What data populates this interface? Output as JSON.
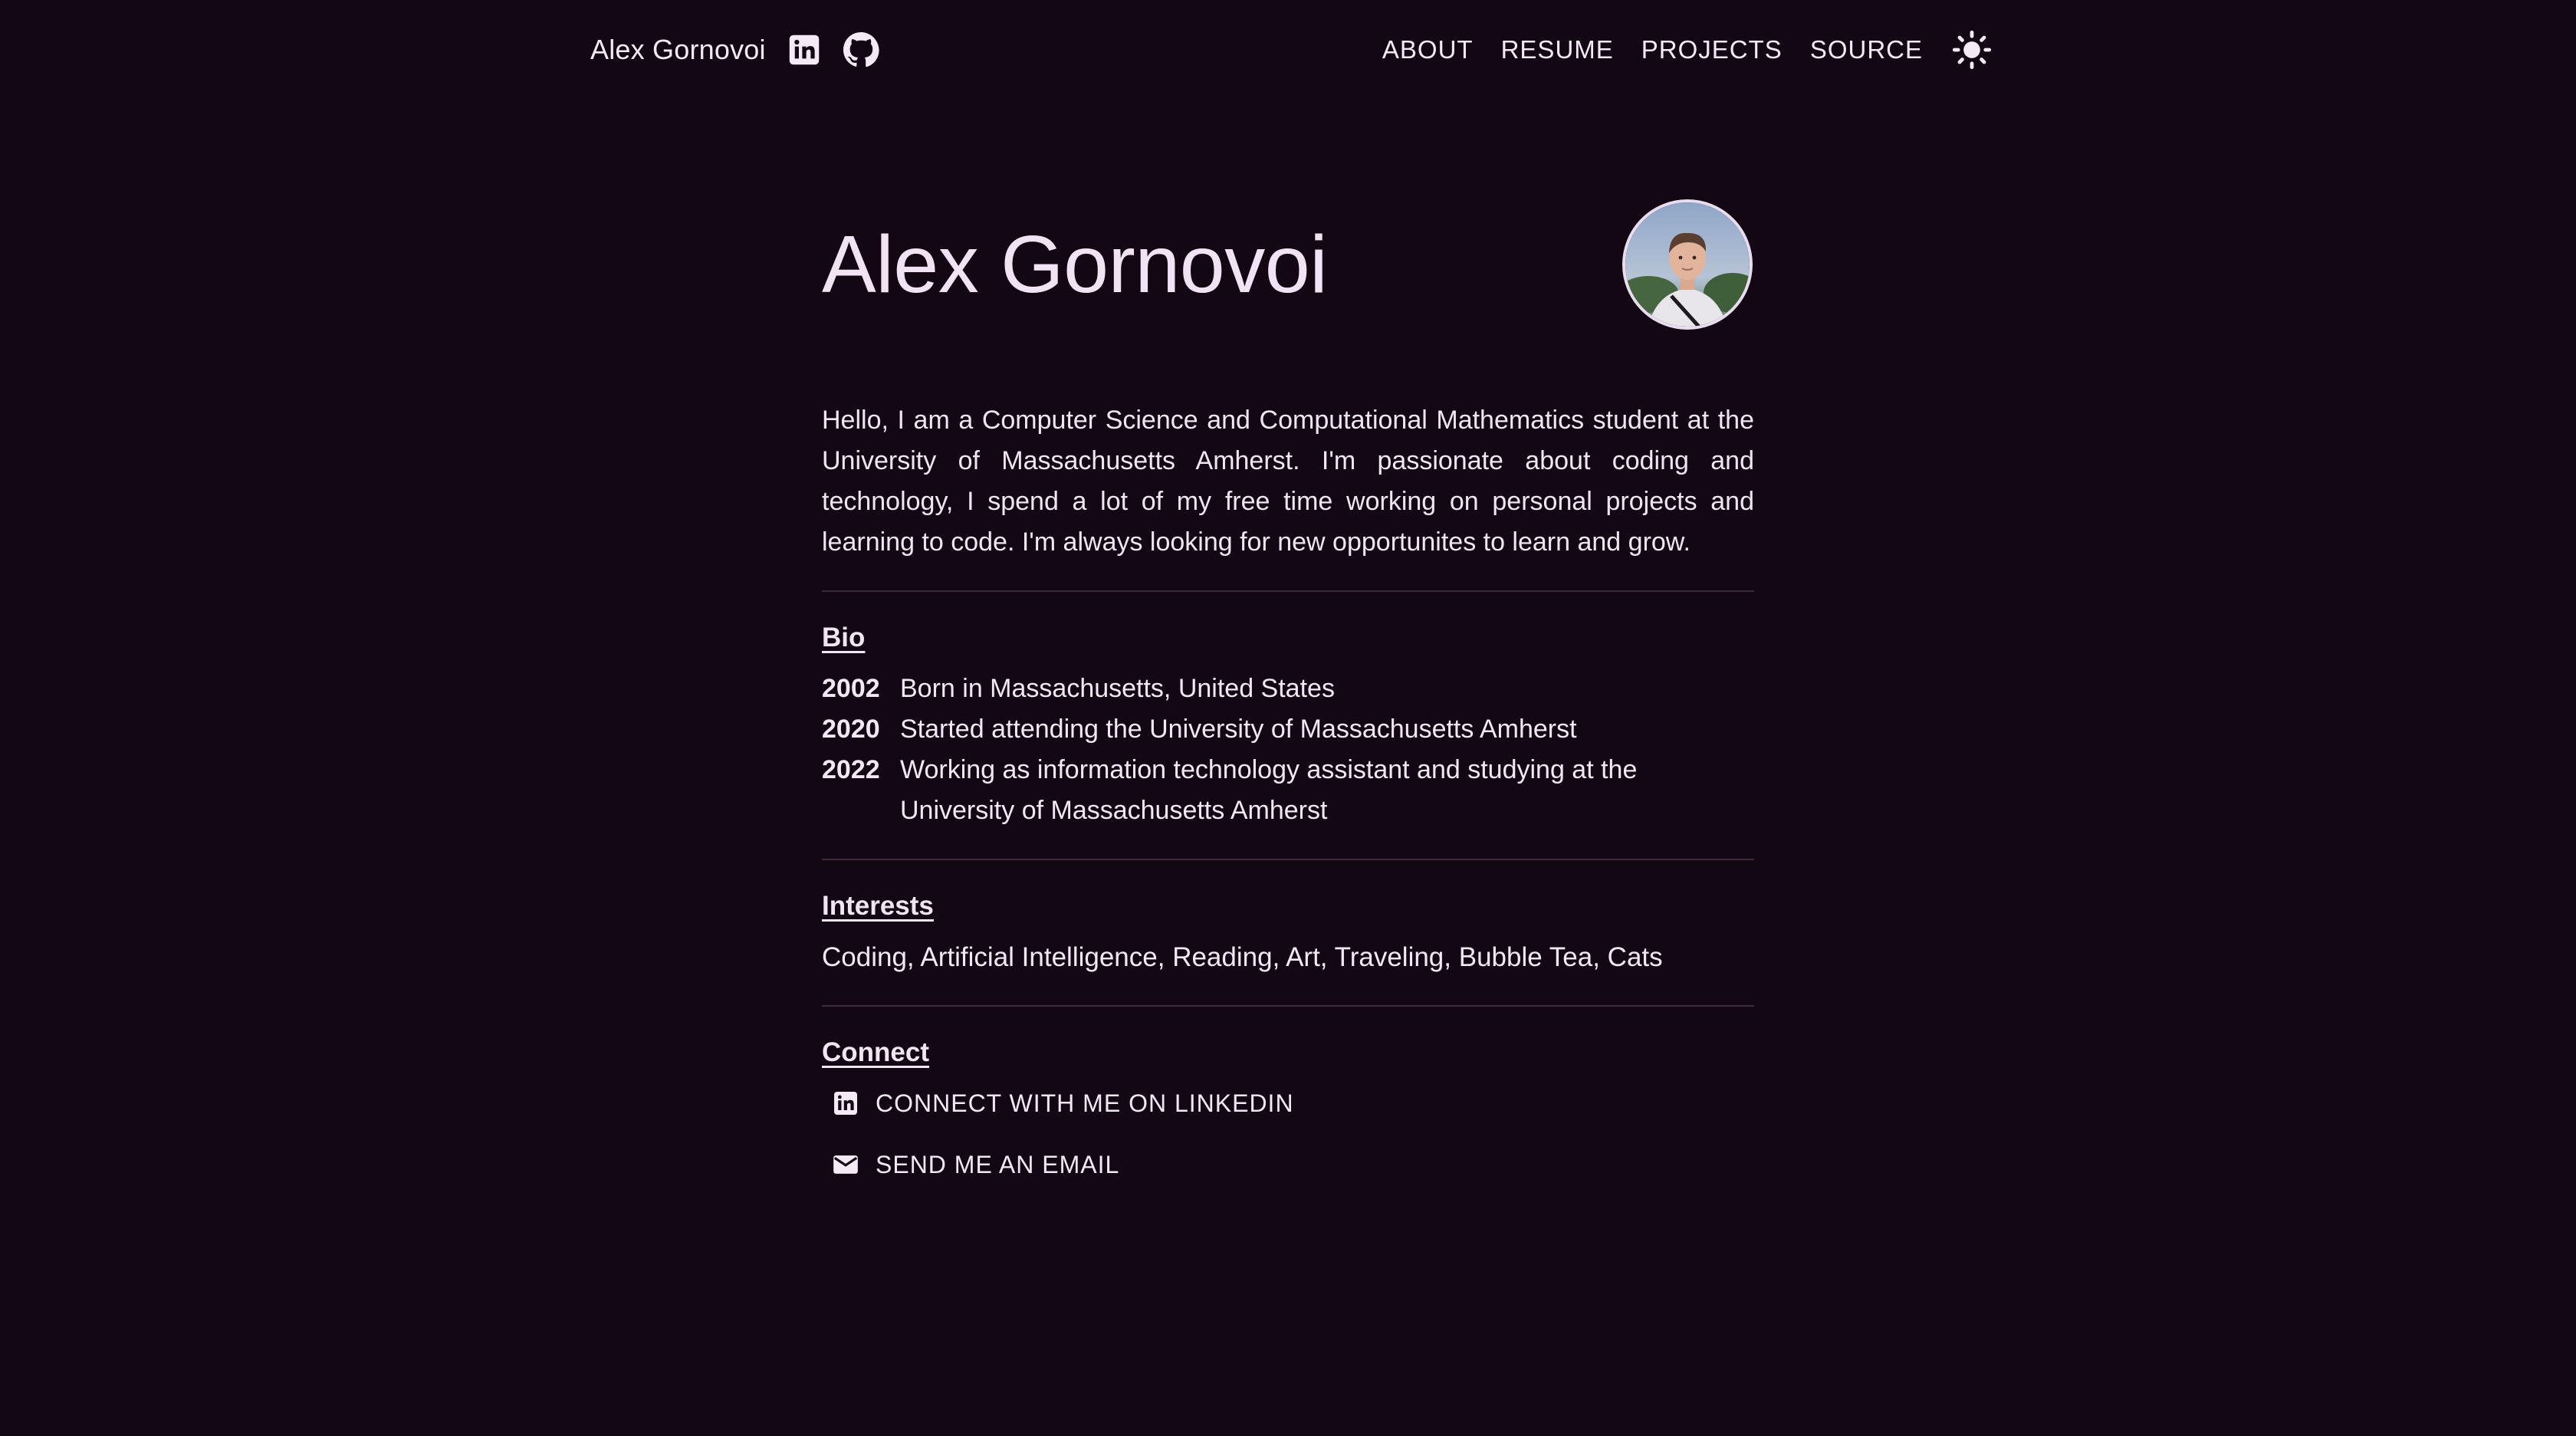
{
  "header": {
    "brand_name": "Alex Gornovoi",
    "icons": {
      "linkedin": "linkedin-icon",
      "github": "github-icon",
      "theme": "sun-icon"
    },
    "nav": [
      {
        "label": "ABOUT"
      },
      {
        "label": "RESUME"
      },
      {
        "label": "PROJECTS"
      },
      {
        "label": "SOURCE"
      }
    ]
  },
  "hero": {
    "title": "Alex Gornovoi",
    "avatar_alt": "profile-photo"
  },
  "intro": "Hello, I am a Computer Science and Computational Mathematics student at the University of Massachusetts Amherst. I'm passionate about coding and technology, I spend a lot of my free time working on personal projects and learning to code. I'm always looking for new opportunites to learn and grow.",
  "bio": {
    "title": "Bio",
    "items": [
      {
        "year": "2002",
        "text": "Born in Massachusetts, United States"
      },
      {
        "year": "2020",
        "text": "Started attending the University of Massachusetts Amherst"
      },
      {
        "year": "2022",
        "text": "Working as information technology assistant and studying at the University of Massachusetts Amherst"
      }
    ]
  },
  "interests": {
    "title": "Interests",
    "text": "Coding, Artificial Intelligence, Reading, Art, Traveling, Bubble Tea, Cats"
  },
  "connect": {
    "title": "Connect",
    "linkedin_label": "CONNECT WITH ME ON LINKEDIN",
    "email_label": "SEND ME AN EMAIL"
  },
  "colors": {
    "background": "#120713",
    "text": "#f3e7f4",
    "divider": "#3a2a3c"
  }
}
